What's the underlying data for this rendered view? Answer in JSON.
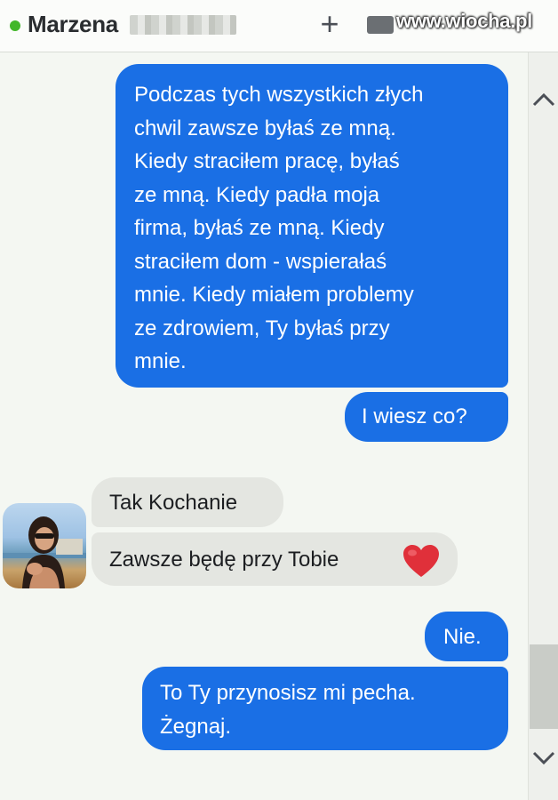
{
  "header": {
    "contact_name": "Marzena",
    "status": "online",
    "add_icon": "plus-icon",
    "video_icon": "video-camera-icon"
  },
  "watermark": "www.wiocha.pl",
  "colors": {
    "outgoing_bubble": "#1a6fe5",
    "incoming_bubble": "#e4e6e1",
    "online_dot": "#42b72a",
    "heart": "#e0303a"
  },
  "messages": [
    {
      "direction": "outgoing",
      "lines": [
        "Podczas tych wszystkich złych",
        "chwil zawsze byłaś ze mną.",
        "Kiedy straciłem pracę, byłaś",
        "ze mną. Kiedy padła moja",
        "firma, byłaś ze mną. Kiedy",
        "straciłem dom - wspierałaś",
        "mnie. Kiedy miałem problemy",
        "ze zdrowiem, Ty byłaś przy",
        "mnie."
      ]
    },
    {
      "direction": "outgoing",
      "lines": [
        "I wiesz co?"
      ]
    },
    {
      "direction": "incoming",
      "lines": [
        "Tak Kochanie"
      ]
    },
    {
      "direction": "incoming",
      "lines": [
        "Zawsze będę przy Tobie"
      ],
      "emoji": "heart-icon"
    },
    {
      "direction": "outgoing",
      "lines": [
        "Nie."
      ]
    },
    {
      "direction": "outgoing",
      "lines": [
        "To Ty przynosisz mi pecha.",
        "Żegnaj."
      ]
    }
  ]
}
